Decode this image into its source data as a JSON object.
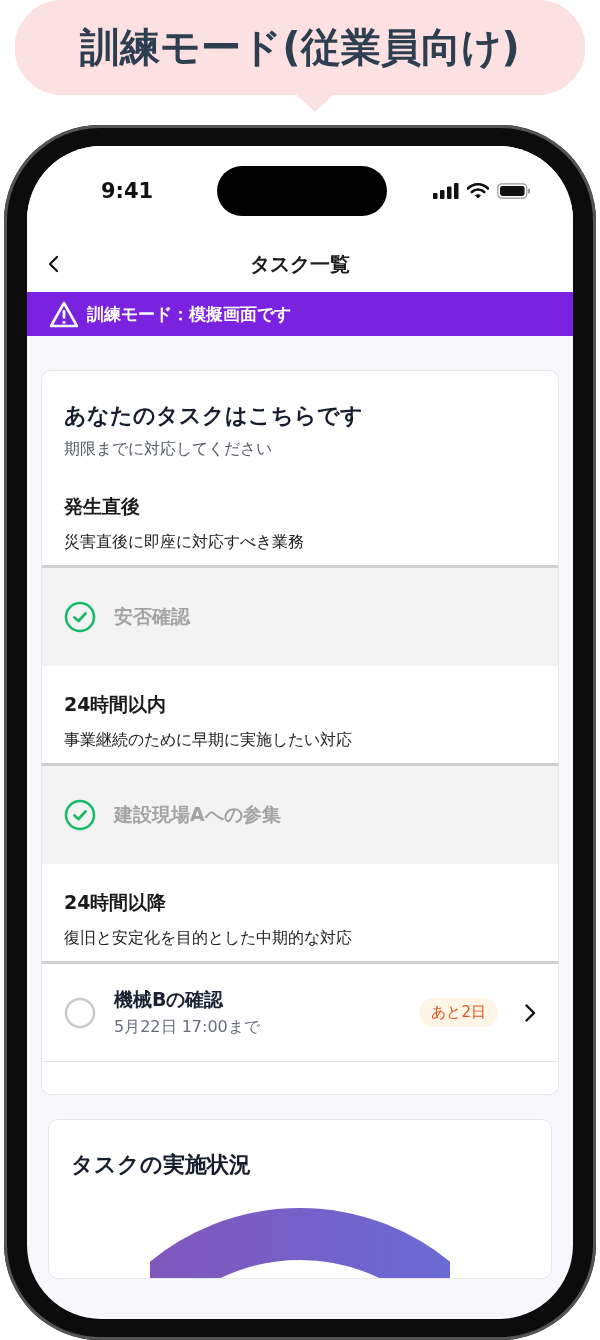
{
  "callout": {
    "title": "訓練モード(従業員向け)"
  },
  "status_bar": {
    "time": "9:41"
  },
  "header": {
    "title": "タスク一覧"
  },
  "banner": {
    "text": "訓練モード：模擬画面です"
  },
  "task_card": {
    "title": "あなたのタスクはこちらです",
    "subtitle": "期限までに対応してください",
    "sections": [
      {
        "title": "発生直後",
        "description": "災害直後に即座に対応すべき業務",
        "tasks": [
          {
            "name": "安否確認",
            "completed": true
          }
        ]
      },
      {
        "title": "24時間以内",
        "description": "事業継続のために早期に実施したい対応",
        "tasks": [
          {
            "name": "建設現場Aへの参集",
            "completed": true
          }
        ]
      },
      {
        "title": "24時間以降",
        "description": "復旧と安定化を目的とした中期的な対応",
        "tasks": [
          {
            "name": "機械Bの確認",
            "completed": false,
            "deadline": "5月22日 17:00まで",
            "badge": "あと2日"
          }
        ]
      }
    ]
  },
  "progress_card": {
    "title": "タスクの実施状況"
  }
}
